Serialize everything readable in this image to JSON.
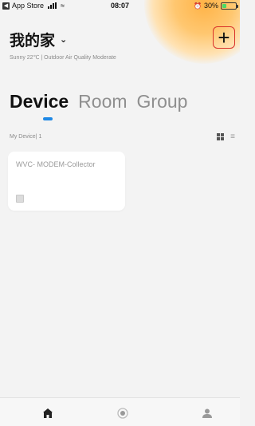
{
  "status_bar": {
    "back_app": "App Store",
    "back_icon": "left-arrow-icon",
    "time": "08:07",
    "battery_percent": "30%",
    "battery_level": 0.3
  },
  "header": {
    "home_name": "我的家",
    "weather_text": "Sunny 22℃  |  Outdoor Air Quality Moderate",
    "add_icon": "plus-icon",
    "accent_color": "#d9322b"
  },
  "tabs": [
    {
      "label": "Device",
      "active": true
    },
    {
      "label": "Room",
      "active": false
    },
    {
      "label": "Group",
      "active": false
    }
  ],
  "devices_header": {
    "label": "My Device",
    "separator": "|",
    "count": "1"
  },
  "devices": [
    {
      "name": "WVC- MODEM-Collector",
      "icon": "device-icon"
    }
  ],
  "bottom_nav": [
    {
      "name": "home",
      "icon": "home-icon",
      "active": true
    },
    {
      "name": "scene",
      "icon": "scene-icon",
      "active": false
    },
    {
      "name": "me",
      "icon": "user-icon",
      "active": false
    }
  ],
  "colors": {
    "tab_indicator": "#1e88e5",
    "background": "#f3f3f3"
  }
}
